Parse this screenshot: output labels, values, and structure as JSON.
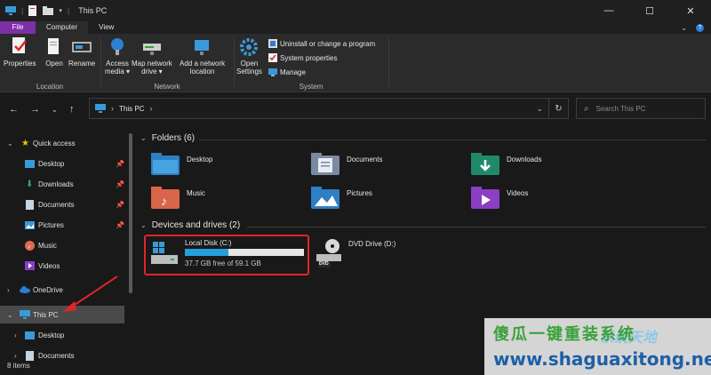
{
  "window": {
    "title": "This PC",
    "minimize": "—",
    "maximize": "☐",
    "close": "✕"
  },
  "ribbon_tabs": [
    "File",
    "Computer",
    "View"
  ],
  "ribbon": {
    "location": {
      "group": "Location",
      "properties": "Properties",
      "open": "Open",
      "rename": "Rename"
    },
    "network": {
      "group": "Network",
      "access_media_1": "Access",
      "access_media_2": "media ▾",
      "map_drive_1": "Map network",
      "map_drive_2": "drive ▾",
      "add_location_1": "Add a network",
      "add_location_2": "location"
    },
    "system": {
      "group": "System",
      "open_settings_1": "Open",
      "open_settings_2": "Settings",
      "uninstall": "Uninstall or change a program",
      "system_properties": "System properties",
      "manage": "Manage"
    }
  },
  "address": {
    "path": "This PC",
    "sep": "›",
    "search_placeholder": "Search This PC"
  },
  "sidebar": {
    "quick_access": "Quick access",
    "items": [
      {
        "label": "Desktop"
      },
      {
        "label": "Downloads"
      },
      {
        "label": "Documents"
      },
      {
        "label": "Pictures"
      },
      {
        "label": "Music"
      },
      {
        "label": "Videos"
      }
    ],
    "onedrive": "OneDrive",
    "this_pc": "This PC",
    "this_pc_children": [
      {
        "label": "Desktop"
      },
      {
        "label": "Documents"
      }
    ]
  },
  "folders": {
    "heading": "Folders (6)",
    "items": [
      {
        "label": "Desktop"
      },
      {
        "label": "Documents"
      },
      {
        "label": "Downloads"
      },
      {
        "label": "Music"
      },
      {
        "label": "Pictures"
      },
      {
        "label": "Videos"
      }
    ]
  },
  "drives": {
    "heading": "Devices and drives (2)",
    "local": {
      "label": "Local Disk (C:)",
      "free_text": "37.7 GB free of 59.1 GB",
      "used_fraction": 0.362
    },
    "dvd": {
      "label": "DVD Drive (D:)",
      "badge": "DVD"
    }
  },
  "status": {
    "items": "8 items"
  },
  "watermark": {
    "cn": "傻瓜一键重装系统",
    "en": "www.shaguaxitong.net",
    "logo": "系统天地"
  },
  "colors": {
    "accent_purple": "#7d2fa5",
    "folder_blue": "#3a9ad9",
    "annotation_red": "#e0242b",
    "drive_bar": "#26a0da"
  }
}
